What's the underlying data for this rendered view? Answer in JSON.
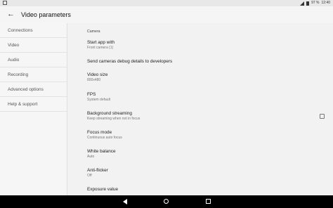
{
  "status_bar": {
    "battery": "97 %",
    "time": "12:40",
    "icons": [
      "notification-icon",
      "signal-icon",
      "battery-icon"
    ]
  },
  "app_bar": {
    "title": "Video parameters",
    "back_icon": "arrow-back-icon"
  },
  "sidebar": {
    "items": [
      {
        "label": "Connections"
      },
      {
        "label": "Video"
      },
      {
        "label": "Audio"
      },
      {
        "label": "Recording"
      },
      {
        "label": "Advanced options"
      },
      {
        "label": "Help & support"
      }
    ]
  },
  "content": {
    "section_header": "Camera",
    "prefs": [
      {
        "title": "Start app with",
        "summary": "Front camera (1)"
      },
      {
        "title": "Send cameras debug details to developers",
        "summary": ""
      },
      {
        "title": "Video size",
        "summary": "800x480"
      },
      {
        "title": "FPS",
        "summary": "System default"
      },
      {
        "title": "Background streaming",
        "summary": "Keep streaming when not in focus",
        "checked": false
      },
      {
        "title": "Focus mode",
        "summary": "Continuous auto focus"
      },
      {
        "title": "White balance",
        "summary": "Auto"
      },
      {
        "title": "Anti-flicker",
        "summary": "Off"
      },
      {
        "title": "Exposure value",
        "summary": ""
      }
    ]
  },
  "nav_bar": {
    "icons": [
      "back-triangle-icon",
      "home-circle-icon",
      "recents-square-icon"
    ]
  }
}
